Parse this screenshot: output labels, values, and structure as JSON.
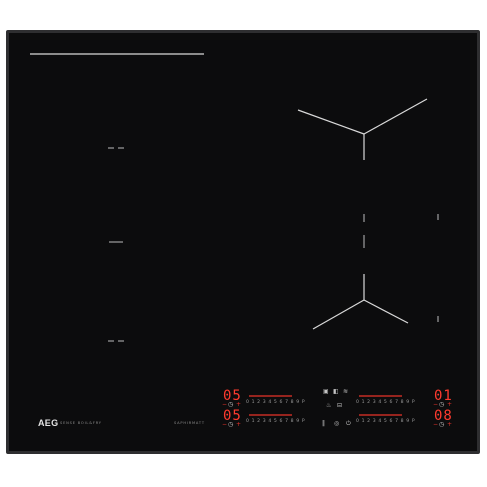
{
  "brand": {
    "logo": "AEG",
    "series": "SENSE BOIL&FRY",
    "model": "SAPHIRMATT"
  },
  "zones": {
    "top_left": {
      "display": "05",
      "scale": "0 1 2 3 4 5 6 7 8 9 P",
      "minus": "−",
      "plus": "+",
      "timer_icon": "timer-icon"
    },
    "bottom_left": {
      "display": "05",
      "scale": "0 1 2 3 4 5 6 7 8 9 P",
      "minus": "−",
      "plus": "+",
      "timer_icon": "timer-icon"
    },
    "top_right": {
      "display": "01",
      "scale": "0 1 2 3 4 5 6 7 8 9 P",
      "minus": "−",
      "plus": "+",
      "timer_icon": "timer-icon"
    },
    "bottom_right": {
      "display": "08",
      "scale": "0 1 2 3 4 5 6 7 8 9 P",
      "minus": "−",
      "plus": "+",
      "timer_icon": "timer-icon"
    }
  },
  "center_controls": {
    "top_row": [
      "▣",
      "◧",
      "≋"
    ],
    "middle_row": [
      "♨",
      "⊟"
    ],
    "bottom_row": [
      "‖",
      "◎",
      "⏻"
    ]
  },
  "colors": {
    "glass": "#0c0c0d",
    "frame": "#2e2e30",
    "display_red": "#ff3b2f",
    "markings": "#d9d9d9"
  }
}
